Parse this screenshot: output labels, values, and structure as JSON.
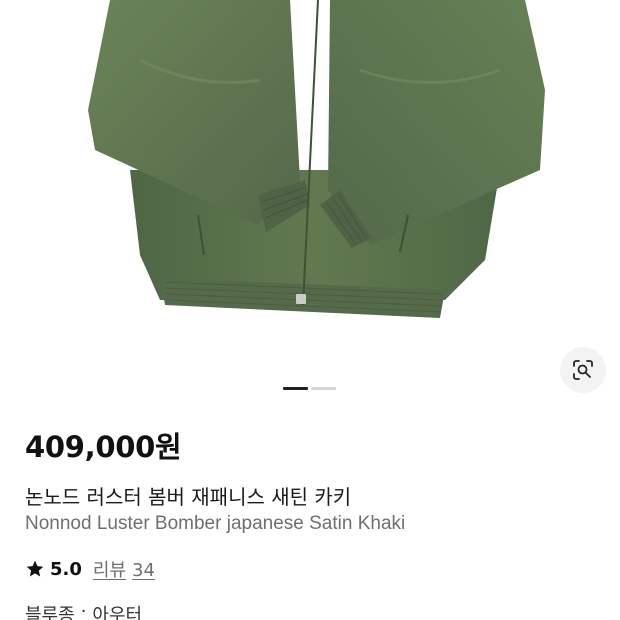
{
  "product": {
    "price": "409,000원",
    "title_ko": "논노드 러스터 봄버 재패니스 새틴 카키",
    "title_en": "Nonnod Luster Bomber japanese Satin Khaki",
    "rating": "5.0",
    "reviews_label": "리뷰",
    "reviews_count": "34",
    "category": "블루종",
    "category_separator": "·",
    "subcategory": "아우터"
  },
  "gallery": {
    "current_page": 1,
    "total_pages": 2,
    "image_subject": "khaki-bomber-jacket"
  },
  "icons": {
    "lens": "image-search-icon",
    "star": "star-icon"
  },
  "colors": {
    "jacket": "#5d7550",
    "star": "#111111",
    "pager_active": "#222222",
    "pager_inactive": "#d6d6d6"
  }
}
